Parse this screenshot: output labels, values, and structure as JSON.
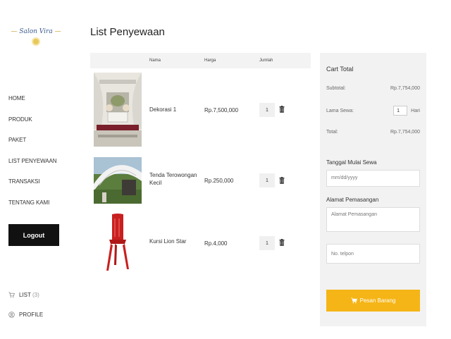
{
  "brand": {
    "logo_text": "Salon Vira",
    "logo_dash": "—"
  },
  "sidebar": {
    "items": [
      {
        "label": "HOME"
      },
      {
        "label": "PRODUK"
      },
      {
        "label": "PAKET"
      },
      {
        "label": "LIST PENYEWAAN"
      },
      {
        "label": "TRANSAKSI"
      },
      {
        "label": "TENTANG KAMI"
      }
    ],
    "logout_label": "Logout",
    "list_label": "LIST",
    "list_count": "(3)",
    "profile_label": "PROFILE"
  },
  "main": {
    "title": "List Penyewaan",
    "columns": {
      "name": "Nama",
      "price": "Harga",
      "qty": "Jumlah"
    },
    "rows": [
      {
        "name": "Dekorasi 1",
        "price": "Rp.7,500,000",
        "qty": "1"
      },
      {
        "name": "Tenda Terowongan Kecil",
        "price": "Rp.250,000",
        "qty": "1"
      },
      {
        "name": "Kursi Lion Star",
        "price": "Rp.4,000",
        "qty": "1"
      }
    ]
  },
  "cart": {
    "title": "Cart Total",
    "subtotal_label": "Subtotal:",
    "subtotal_value": "Rp.7,754,000",
    "duration_label": "Lama Sewa:",
    "duration_value": "1",
    "duration_unit": "Hari",
    "total_label": "Total:",
    "total_value": "Rp.7,754,000",
    "start_date_label": "Tanggal Mulai Sewa",
    "start_date_placeholder": "mm/dd/yyyy",
    "address_label": "Alamat Pemasangan",
    "address_placeholder": "Alamat Pemasangan",
    "phone_placeholder": "No. telpon",
    "order_label": "Pesan Barang"
  },
  "colors": {
    "accent": "#f5b516",
    "logout": "#111111",
    "panel": "#f2f2f2"
  }
}
